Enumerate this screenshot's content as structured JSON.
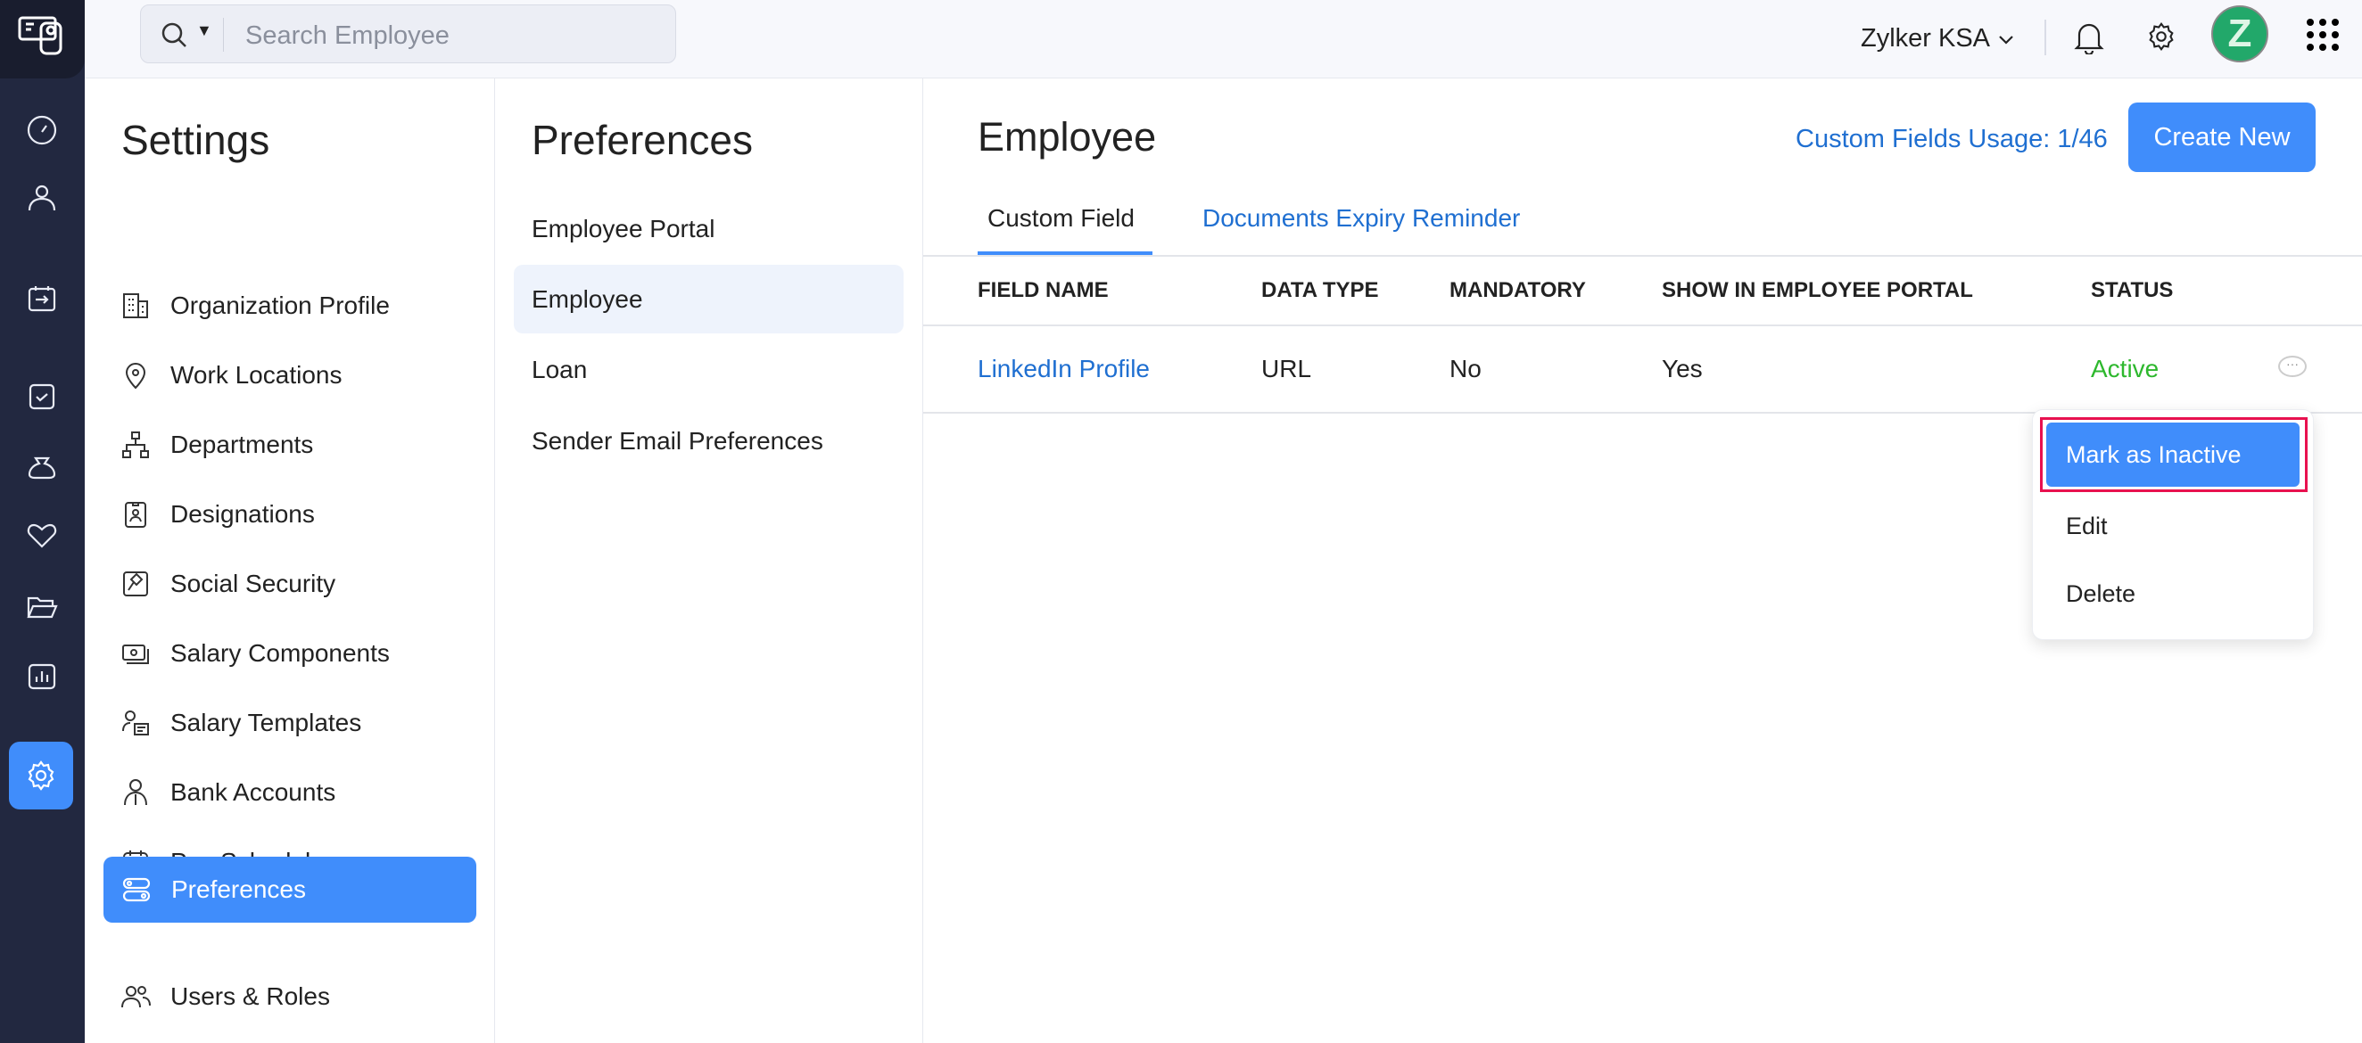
{
  "topbar": {
    "search_placeholder": "Search Employee",
    "org_name": "Zylker KSA",
    "avatar_letter": "Z"
  },
  "rail": {
    "icons": [
      "logo-icon",
      "dashboard-icon",
      "employees-icon",
      "leave-icon",
      "approvals-icon",
      "payroll-icon",
      "benefits-icon",
      "documents-icon",
      "reports-icon",
      "settings-icon"
    ]
  },
  "settings": {
    "title": "Settings",
    "items": [
      {
        "label": "Organization Profile",
        "icon": "building-icon"
      },
      {
        "label": "Work Locations",
        "icon": "location-pin-icon"
      },
      {
        "label": "Departments",
        "icon": "org-chart-icon"
      },
      {
        "label": "Designations",
        "icon": "id-badge-icon"
      },
      {
        "label": "Social Security",
        "icon": "gavel-icon"
      },
      {
        "label": "Salary Components",
        "icon": "money-icon"
      },
      {
        "label": "Salary Templates",
        "icon": "template-icon"
      },
      {
        "label": "Bank Accounts",
        "icon": "bank-user-icon"
      },
      {
        "label": "Pay Schedule",
        "icon": "calendar-icon"
      }
    ],
    "active": {
      "label": "Preferences",
      "icon": "toggles-icon"
    },
    "users": {
      "label": "Users & Roles",
      "icon": "users-icon"
    }
  },
  "preferences": {
    "title": "Preferences",
    "items": [
      "Employee Portal",
      "Employee",
      "Loan",
      "Sender Email Preferences"
    ],
    "active_index": 1
  },
  "main": {
    "title": "Employee",
    "usage": "Custom Fields Usage: 1/46",
    "create_label": "Create New",
    "tabs": [
      "Custom Field",
      "Documents Expiry Reminder"
    ],
    "columns": [
      "FIELD NAME",
      "DATA TYPE",
      "MANDATORY",
      "SHOW IN EMPLOYEE PORTAL",
      "STATUS"
    ],
    "rows": [
      {
        "field": "LinkedIn Profile",
        "type": "URL",
        "mandatory": "No",
        "portal": "Yes",
        "status": "Active"
      }
    ],
    "menu": [
      "Mark as Inactive",
      "Edit",
      "Delete"
    ]
  },
  "colors": {
    "accent": "#408dfb",
    "link": "#1f6fd1",
    "active_status": "#2eb82e",
    "highlight": "#e8114f"
  }
}
